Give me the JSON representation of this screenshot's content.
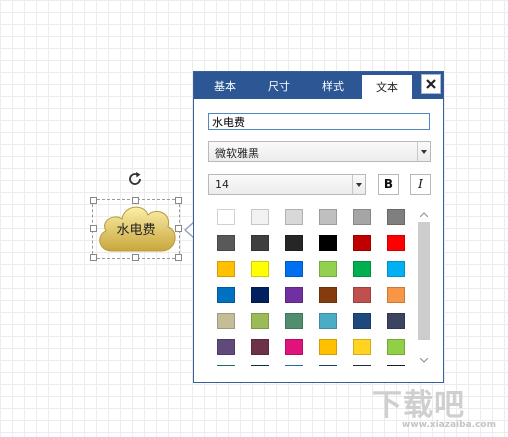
{
  "panel": {
    "tabs": [
      {
        "label": "基本",
        "active": false
      },
      {
        "label": "尺寸",
        "active": false
      },
      {
        "label": "样式",
        "active": false
      },
      {
        "label": "文本",
        "active": true
      }
    ],
    "text_value": "水电费",
    "font_family": "微软雅黑",
    "font_size": "14",
    "bold_label": "B",
    "italic_label": "I",
    "palette": [
      [
        "#ffffff",
        "#f2f2f2",
        "#d8d8d8",
        "#bfbfbf",
        "#a5a5a5",
        "#7f7f7f"
      ],
      [
        "#595959",
        "#3f3f3f",
        "#262626",
        "#000000",
        "#c00000",
        "#ff0000"
      ],
      [
        "#ffc000",
        "#ffff00",
        "#0070f0",
        "#92d050",
        "#00b050",
        "#00b0f0"
      ],
      [
        "#0070c0",
        "#002060",
        "#7030a0",
        "#843c0c",
        "#c0504d",
        "#f79646"
      ],
      [
        "#c4bd97",
        "#9bbb59",
        "#4f8f6f",
        "#4bacc6",
        "#1f497d",
        "#3b4560"
      ],
      [
        "#604a7b",
        "#6d3148",
        "#e0127c",
        "#ffc000",
        "#ffd320",
        "#8fd048"
      ],
      [
        "#1f8a70",
        "#0b3c5d",
        "#2e86c1",
        "#1a5276",
        "#283747",
        "#1c2833"
      ]
    ]
  },
  "canvas": {
    "shape_label": "水电费"
  },
  "watermark": {
    "main": "下载吧",
    "sub": "www.xiazaiba.com"
  }
}
